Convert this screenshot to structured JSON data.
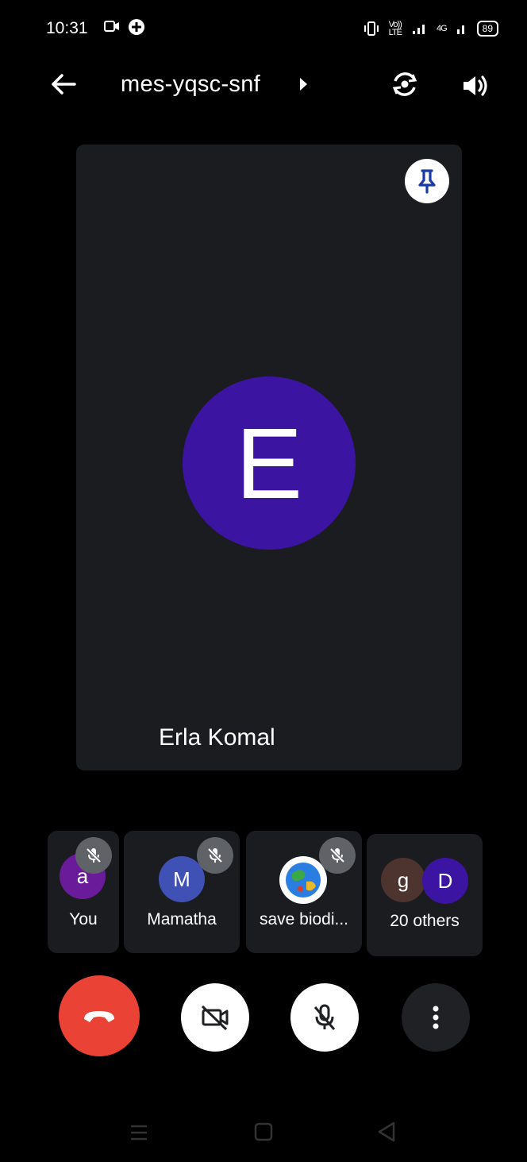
{
  "status_bar": {
    "time": "10:31",
    "volte_top": "Vo))",
    "volte_bottom": "LTE",
    "network": "4G",
    "battery": "89"
  },
  "app_bar": {
    "meeting_code": "mes-yqsc-snf"
  },
  "main_tile": {
    "avatar_letter": "E",
    "avatar_color": "#3b14a2",
    "participant_name": "Erla Komal"
  },
  "participants": {
    "you": {
      "avatar_letter": "a",
      "avatar_color": "#6a1b9a",
      "label": "You"
    },
    "mamatha": {
      "avatar_letter": "M",
      "avatar_color": "#3f51b5",
      "label": "Mamatha"
    },
    "save": {
      "label": "save biodi..."
    },
    "others": {
      "avatar1_letter": "g",
      "avatar1_color": "#4e342e",
      "avatar2_letter": "D",
      "avatar2_color": "#3b14a2",
      "label": "20 others"
    }
  },
  "controls": {
    "end_call_color": "#ea4335",
    "icons": [
      "end-call-icon",
      "camera-off-icon",
      "mic-off-icon",
      "more-vertical-icon"
    ]
  }
}
